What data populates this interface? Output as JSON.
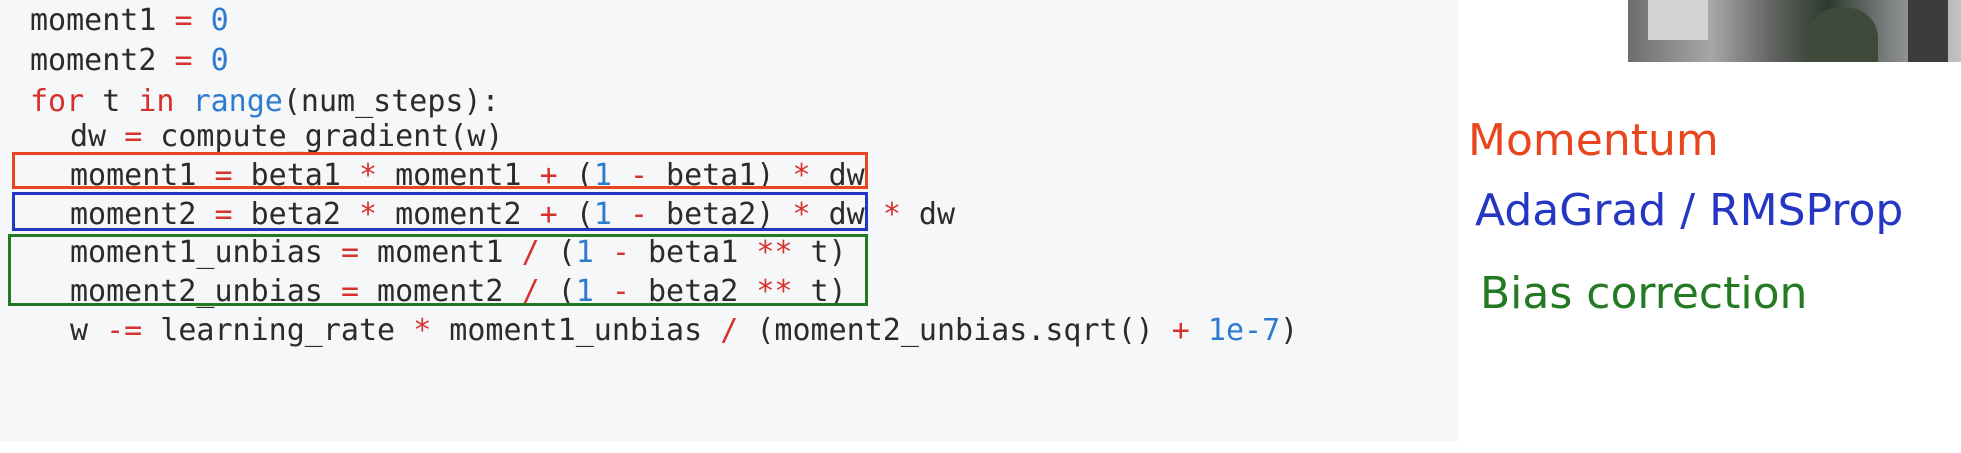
{
  "code": {
    "lines": [
      {
        "indent": false,
        "tokens": [
          {
            "t": "moment1 ",
            "c": "txt"
          },
          {
            "t": "=",
            "c": "op"
          },
          {
            "t": " ",
            "c": "txt"
          },
          {
            "t": "0",
            "c": "num"
          }
        ]
      },
      {
        "indent": false,
        "tokens": [
          {
            "t": "moment2 ",
            "c": "txt"
          },
          {
            "t": "=",
            "c": "op"
          },
          {
            "t": " ",
            "c": "txt"
          },
          {
            "t": "0",
            "c": "num"
          }
        ]
      },
      {
        "indent": false,
        "tokens": [
          {
            "t": "for",
            "c": "kw"
          },
          {
            "t": " t ",
            "c": "txt"
          },
          {
            "t": "in",
            "c": "kw"
          },
          {
            "t": " ",
            "c": "txt"
          },
          {
            "t": "range",
            "c": "fn"
          },
          {
            "t": "(num_steps):",
            "c": "txt"
          }
        ]
      },
      {
        "indent": true,
        "tokens": [
          {
            "t": "dw ",
            "c": "txt"
          },
          {
            "t": "=",
            "c": "op"
          },
          {
            "t": " compute_gradient(w)",
            "c": "txt"
          }
        ]
      },
      {
        "indent": true,
        "tokens": [
          {
            "t": "moment1 ",
            "c": "txt"
          },
          {
            "t": "=",
            "c": "op"
          },
          {
            "t": " beta1 ",
            "c": "txt"
          },
          {
            "t": "*",
            "c": "op"
          },
          {
            "t": " moment1 ",
            "c": "txt"
          },
          {
            "t": "+",
            "c": "op"
          },
          {
            "t": " (",
            "c": "txt"
          },
          {
            "t": "1",
            "c": "num"
          },
          {
            "t": " ",
            "c": "txt"
          },
          {
            "t": "-",
            "c": "op"
          },
          {
            "t": " beta1) ",
            "c": "txt"
          },
          {
            "t": "*",
            "c": "op"
          },
          {
            "t": " dw",
            "c": "txt"
          }
        ]
      },
      {
        "indent": true,
        "tokens": [
          {
            "t": "moment2 ",
            "c": "txt"
          },
          {
            "t": "=",
            "c": "op"
          },
          {
            "t": " beta2 ",
            "c": "txt"
          },
          {
            "t": "*",
            "c": "op"
          },
          {
            "t": " moment2 ",
            "c": "txt"
          },
          {
            "t": "+",
            "c": "op"
          },
          {
            "t": " (",
            "c": "txt"
          },
          {
            "t": "1",
            "c": "num"
          },
          {
            "t": " ",
            "c": "txt"
          },
          {
            "t": "-",
            "c": "op"
          },
          {
            "t": " beta2) ",
            "c": "txt"
          },
          {
            "t": "*",
            "c": "op"
          },
          {
            "t": " dw ",
            "c": "txt"
          },
          {
            "t": "*",
            "c": "op"
          },
          {
            "t": " dw",
            "c": "txt"
          }
        ]
      },
      {
        "indent": true,
        "tokens": [
          {
            "t": "moment1_unbias ",
            "c": "txt"
          },
          {
            "t": "=",
            "c": "op"
          },
          {
            "t": " moment1 ",
            "c": "txt"
          },
          {
            "t": "/",
            "c": "op"
          },
          {
            "t": " (",
            "c": "txt"
          },
          {
            "t": "1",
            "c": "num"
          },
          {
            "t": " ",
            "c": "txt"
          },
          {
            "t": "-",
            "c": "op"
          },
          {
            "t": " beta1 ",
            "c": "txt"
          },
          {
            "t": "**",
            "c": "op"
          },
          {
            "t": " t)",
            "c": "txt"
          }
        ]
      },
      {
        "indent": true,
        "tokens": [
          {
            "t": "moment2_unbias ",
            "c": "txt"
          },
          {
            "t": "=",
            "c": "op"
          },
          {
            "t": " moment2 ",
            "c": "txt"
          },
          {
            "t": "/",
            "c": "op"
          },
          {
            "t": " (",
            "c": "txt"
          },
          {
            "t": "1",
            "c": "num"
          },
          {
            "t": " ",
            "c": "txt"
          },
          {
            "t": "-",
            "c": "op"
          },
          {
            "t": " beta2 ",
            "c": "txt"
          },
          {
            "t": "**",
            "c": "op"
          },
          {
            "t": " t)",
            "c": "txt"
          }
        ]
      },
      {
        "indent": true,
        "tokens": [
          {
            "t": "w ",
            "c": "txt"
          },
          {
            "t": "-=",
            "c": "op"
          },
          {
            "t": " learning_rate ",
            "c": "txt"
          },
          {
            "t": "*",
            "c": "op"
          },
          {
            "t": " moment1_unbias ",
            "c": "txt"
          },
          {
            "t": "/",
            "c": "op"
          },
          {
            "t": " (moment2_unbias.sqrt() ",
            "c": "txt"
          },
          {
            "t": "+",
            "c": "op"
          },
          {
            "t": " ",
            "c": "txt"
          },
          {
            "t": "1e-7",
            "c": "num"
          },
          {
            "t": ")",
            "c": "txt"
          }
        ]
      }
    ]
  },
  "annotations": {
    "momentum": {
      "text": "Momentum",
      "color": "#e8461e"
    },
    "adagrad": {
      "text": "AdaGrad / RMSProp",
      "color": "#2436c2"
    },
    "bias": {
      "text": "Bias correction",
      "color": "#237a23"
    }
  },
  "colors": {
    "keyword": "#d7312e",
    "number": "#2f7bd0",
    "text": "#2b2b2b",
    "panel_bg": "#f6f7f8"
  }
}
